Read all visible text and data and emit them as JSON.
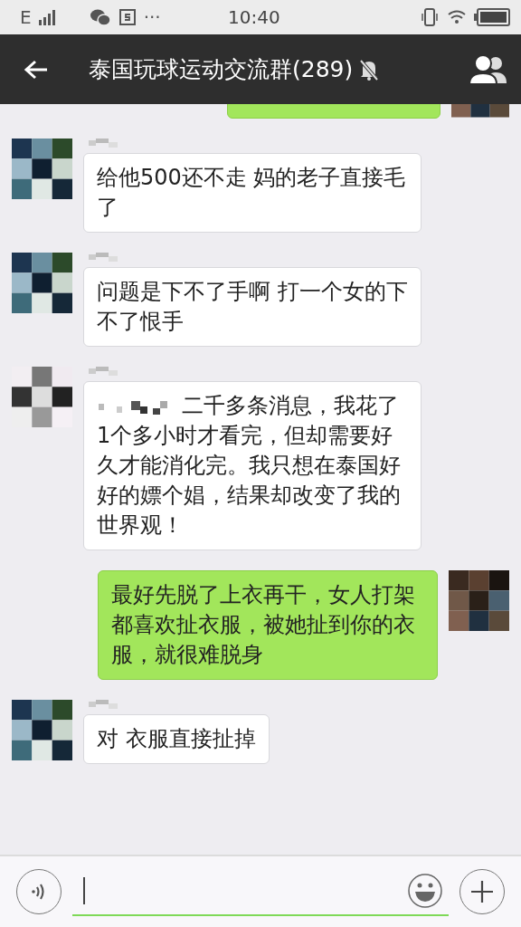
{
  "status_bar": {
    "network": "E",
    "notification_more": "···",
    "time": "10:40"
  },
  "header": {
    "title": "泰国玩球运动交流群(289)",
    "muted": true
  },
  "messages": [
    {
      "kind": "outgoing",
      "cut": true
    },
    {
      "kind": "incoming",
      "censored_prefix": false,
      "text": "给他500还不走 妈的老子直接毛了"
    },
    {
      "kind": "incoming",
      "censored_prefix": false,
      "text": "问题是下不了手啊 打一个女的下不了恨手"
    },
    {
      "kind": "incoming",
      "censored_prefix": true,
      "text": "二千多条消息，我花了1个多小时才看完，但却需要好久才能消化完。我只想在泰国好好的嫖个娼，结果却改变了我的世界观！"
    },
    {
      "kind": "outgoing",
      "cut": false,
      "text": "最好先脱了上衣再干，女人打架都喜欢扯衣服，被她扯到你的衣服，就很难脱身"
    },
    {
      "kind": "incoming",
      "censored_prefix": false,
      "text": "对 衣服直接扯掉"
    }
  ]
}
